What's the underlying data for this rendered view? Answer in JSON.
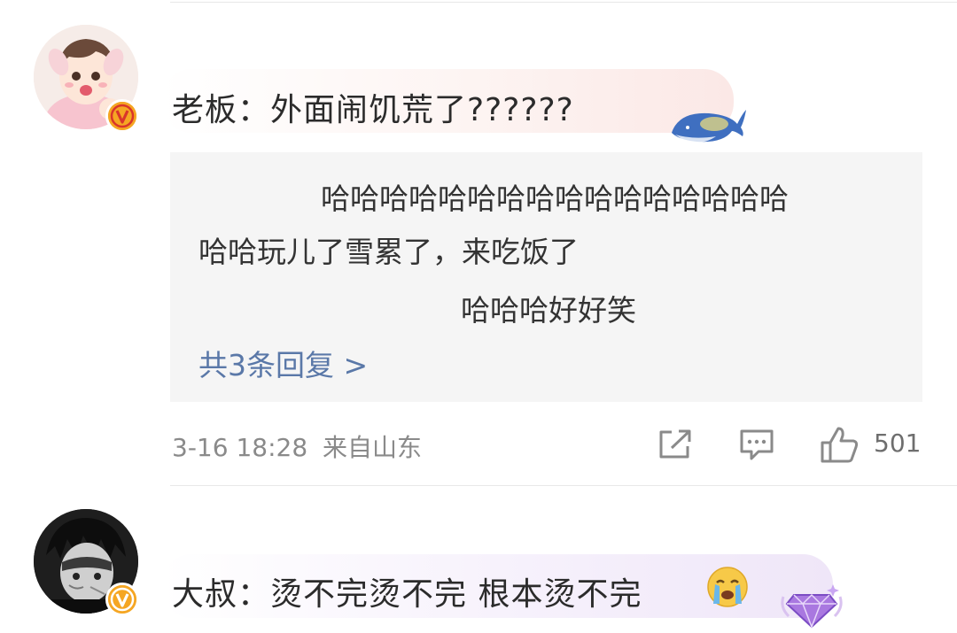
{
  "comment1": {
    "username": "老板",
    "separator": "：",
    "text": "外面闹饥荒了??????",
    "avatar_icon": "cartoon-girl-avatar",
    "badge_icon": "verified-v-icon",
    "bubble_deco_icon": "blue-whale-icon",
    "replies": [
      "哈哈哈哈哈哈哈哈哈哈哈哈哈哈哈哈",
      "哈哈玩儿了雪累了，来吃饭了",
      "哈哈哈好好笑"
    ],
    "more_replies": "共3条回复 >",
    "timestamp": "3-16 18:28",
    "location": "来自山东",
    "like_count": "501",
    "share_icon": "share-icon",
    "comment_icon": "comment-icon",
    "like_icon": "thumbs-up-icon"
  },
  "comment2": {
    "username": "大叔",
    "separator": "：",
    "text": "烫不完烫不完 根本烫不完",
    "emoji": "😭",
    "avatar_icon": "dark-anime-avatar",
    "badge_icon": "verified-v-icon",
    "bubble_deco_icon": "purple-gem-icon"
  },
  "colors": {
    "link": "#5a78a8",
    "meta": "#8a8a8a",
    "badge_orange": "#f5a623",
    "reply_bg": "#f5f5f5"
  }
}
